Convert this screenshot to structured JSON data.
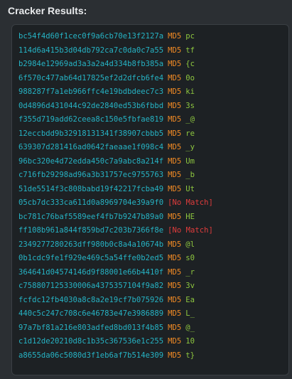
{
  "title": "Cracker Results:",
  "colors": {
    "hash": "#26b3c4",
    "algorithm": "#f08a24",
    "plaintext": "#8dc63f",
    "no_match": "#e03c3c"
  },
  "results": [
    {
      "hash": "bc54f4d60f1cec0f9a6cb70e13f2127a",
      "algo": "MD5",
      "plain": "pc"
    },
    {
      "hash": "114d6a415b3d04db792ca7c0da0c7a55",
      "algo": "MD5",
      "plain": "tf"
    },
    {
      "hash": "b2984e12969ad3a3a2a4d334b8fb385a",
      "algo": "MD5",
      "plain": "{c"
    },
    {
      "hash": "6f570c477ab64d17825ef2d2dfcb6fe4",
      "algo": "MD5",
      "plain": "0o"
    },
    {
      "hash": "988287f7a1eb966ffc4e19bdbdeec7c3",
      "algo": "MD5",
      "plain": "ki"
    },
    {
      "hash": "0d4896d431044c92de2840ed53b6fbbd",
      "algo": "MD5",
      "plain": "3s"
    },
    {
      "hash": "f355d719add62ceea8c150e5fbfae819",
      "algo": "MD5",
      "plain": "_@"
    },
    {
      "hash": "12eccbdd9b32918131341f38907cbbb5",
      "algo": "MD5",
      "plain": "re"
    },
    {
      "hash": "639307d281416ad0642faeaae1f098c4",
      "algo": "MD5",
      "plain": "_y"
    },
    {
      "hash": "96bc320e4d72edda450c7a9abc8a214f",
      "algo": "MD5",
      "plain": "Um"
    },
    {
      "hash": "c716fb29298ad96a3b31757ec9755763",
      "algo": "MD5",
      "plain": "_b"
    },
    {
      "hash": "51de5514f3c808babd19f42217fcba49",
      "algo": "MD5",
      "plain": "Ut"
    },
    {
      "hash": "05cb7dc333ca611d0a8969704e39a9f0",
      "algo": "",
      "plain": "[No Match]",
      "nomatch": true
    },
    {
      "hash": "bc781c76baf5589eef4fb7b9247b89a0",
      "algo": "MD5",
      "plain": "HE"
    },
    {
      "hash": "ff108b961a844f859bd7c203b7366f8e",
      "algo": "",
      "plain": "[No Match]",
      "nomatch": true
    },
    {
      "hash": "2349277280263dff980b0c8a4a10674b",
      "algo": "MD5",
      "plain": "@l"
    },
    {
      "hash": "0b1cdc9fe1f929e469c5a54ffe0b2ed5",
      "algo": "MD5",
      "plain": "s0"
    },
    {
      "hash": "364641d04574146d9f88001e66b4410f",
      "algo": "MD5",
      "plain": "_r"
    },
    {
      "hash": "c758807125330006a4375357104f9a82",
      "algo": "MD5",
      "plain": "3v"
    },
    {
      "hash": "fcfdc12fb4030a8c8a2e19cf7b075926",
      "algo": "MD5",
      "plain": "Ea"
    },
    {
      "hash": "440c5c247c708c6e46783e47e3986889",
      "algo": "MD5",
      "plain": "L_"
    },
    {
      "hash": "97a7bf81a216e803adfed8bd013f4b85",
      "algo": "MD5",
      "plain": "@_"
    },
    {
      "hash": "c1d12de20210d8c1b35c367536e1c255",
      "algo": "MD5",
      "plain": "10"
    },
    {
      "hash": "a8655da06c5080d3f1eb6af7b514e309",
      "algo": "MD5",
      "plain": "t}"
    }
  ]
}
